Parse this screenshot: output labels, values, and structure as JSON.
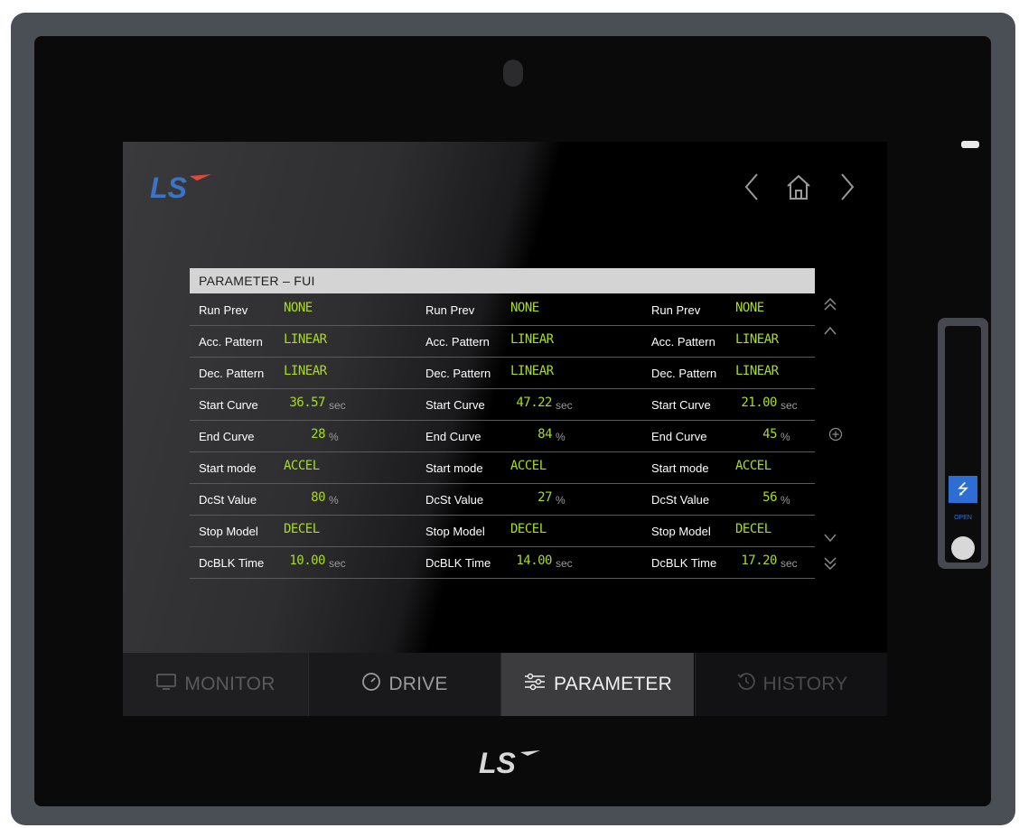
{
  "brand": {
    "logo_text": "LS"
  },
  "hardware": {
    "usb_open_label": "OPEN",
    "usb_icon": "usb-icon"
  },
  "colors": {
    "value_green": "#a8dc1e",
    "accent_red": "#e04a3a",
    "brand_blue": "#3a74c8"
  },
  "nav": {
    "prev_icon": "chevron-left-icon",
    "home_icon": "home-icon",
    "next_icon": "chevron-right-icon"
  },
  "panel": {
    "title": "PARAMETER – FUI",
    "rows": [
      {
        "cols": [
          {
            "label": "Run Prev",
            "value": "NONE",
            "unit": ""
          },
          {
            "label": "Run Prev",
            "value": "NONE",
            "unit": ""
          },
          {
            "label": "Run Prev",
            "value": "NONE",
            "unit": ""
          }
        ]
      },
      {
        "cols": [
          {
            "label": "Acc. Pattern",
            "value": "LINEAR",
            "unit": ""
          },
          {
            "label": "Acc. Pattern",
            "value": "LINEAR",
            "unit": ""
          },
          {
            "label": "Acc. Pattern",
            "value": "LINEAR",
            "unit": ""
          }
        ]
      },
      {
        "cols": [
          {
            "label": "Dec. Pattern",
            "value": "LINEAR",
            "unit": ""
          },
          {
            "label": "Dec. Pattern",
            "value": "LINEAR",
            "unit": ""
          },
          {
            "label": "Dec. Pattern",
            "value": "LINEAR",
            "unit": ""
          }
        ]
      },
      {
        "cols": [
          {
            "label": "Start Curve",
            "value": "36.57",
            "unit": "sec"
          },
          {
            "label": "Start Curve",
            "value": "47.22",
            "unit": "sec"
          },
          {
            "label": "Start Curve",
            "value": "21.00",
            "unit": "sec"
          }
        ]
      },
      {
        "cols": [
          {
            "label": "End Curve",
            "value": "28",
            "unit": "%"
          },
          {
            "label": "End Curve",
            "value": "84",
            "unit": "%"
          },
          {
            "label": "End Curve",
            "value": "45",
            "unit": "%"
          }
        ]
      },
      {
        "cols": [
          {
            "label": "Start mode",
            "value": "ACCEL",
            "unit": ""
          },
          {
            "label": "Start mode",
            "value": "ACCEL",
            "unit": ""
          },
          {
            "label": "Start mode",
            "value": "ACCEL",
            "unit": ""
          }
        ]
      },
      {
        "cols": [
          {
            "label": "DcSt Value",
            "value": "80",
            "unit": "%"
          },
          {
            "label": "DcSt Value",
            "value": "27",
            "unit": "%"
          },
          {
            "label": "DcSt Value",
            "value": "56",
            "unit": "%"
          }
        ]
      },
      {
        "cols": [
          {
            "label": "Stop Model",
            "value": "DECEL",
            "unit": ""
          },
          {
            "label": "Stop Model",
            "value": "DECEL",
            "unit": ""
          },
          {
            "label": "Stop Model",
            "value": "DECEL",
            "unit": ""
          }
        ]
      },
      {
        "cols": [
          {
            "label": "DcBLK Time",
            "value": "10.00",
            "unit": "sec"
          },
          {
            "label": "DcBLK Time",
            "value": "14.00",
            "unit": "sec"
          },
          {
            "label": "DcBLK Time",
            "value": "17.20",
            "unit": "sec"
          }
        ]
      }
    ]
  },
  "scroll": {
    "page_up_icon": "double-chevron-up-icon",
    "up_icon": "chevron-up-icon",
    "add_icon": "plus-circle-icon",
    "down_icon": "chevron-down-icon",
    "page_down_icon": "double-chevron-down-icon"
  },
  "tabs": [
    {
      "label": "MONITOR",
      "icon": "monitor-icon"
    },
    {
      "label": "DRIVE",
      "icon": "gauge-icon"
    },
    {
      "label": "PARAMETER",
      "icon": "sliders-icon",
      "active": true
    },
    {
      "label": "HISTORY",
      "icon": "history-icon"
    }
  ]
}
